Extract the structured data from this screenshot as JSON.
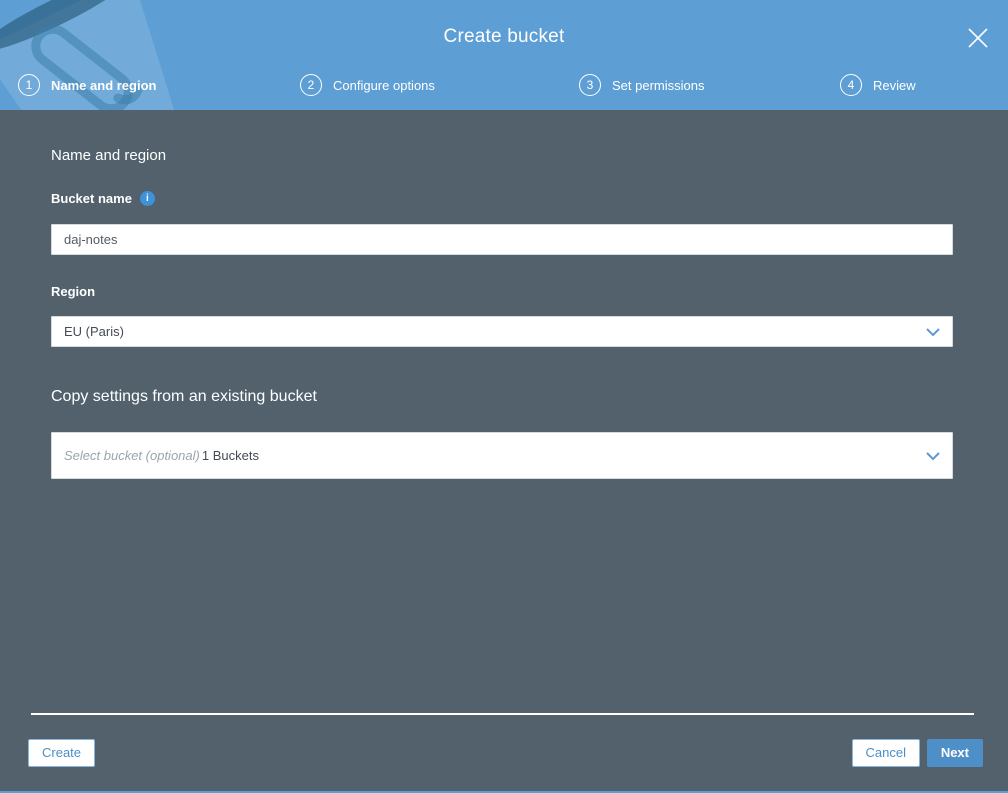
{
  "header": {
    "title": "Create bucket",
    "steps": [
      {
        "number": "1",
        "label": "Name and region"
      },
      {
        "number": "2",
        "label": "Configure options"
      },
      {
        "number": "3",
        "label": "Set permissions"
      },
      {
        "number": "4",
        "label": "Review"
      }
    ]
  },
  "form": {
    "section_title": "Name and region",
    "bucket_name_label": "Bucket name",
    "bucket_name_value": "daj-notes",
    "region_label": "Region",
    "region_value": "EU (Paris)",
    "copy_section_title": "Copy settings from an existing bucket",
    "copy_placeholder": "Select bucket (optional)",
    "copy_bucket_count": "1 Buckets"
  },
  "footer": {
    "create_label": "Create",
    "cancel_label": "Cancel",
    "next_label": "Next"
  },
  "icons": {
    "close": "close-icon",
    "info": "i",
    "chevron_down": "chevron-down-icon",
    "bucket_watermark": "bucket-watermark-icon"
  },
  "colors": {
    "header_blue": "#5d9fd4",
    "body_slate": "#52616c",
    "primary_button_blue": "#4e8fc7",
    "button_text_blue": "#4a8fc8",
    "info_icon_blue": "#3e93d8",
    "chevron_blue": "#5c9ad2"
  }
}
